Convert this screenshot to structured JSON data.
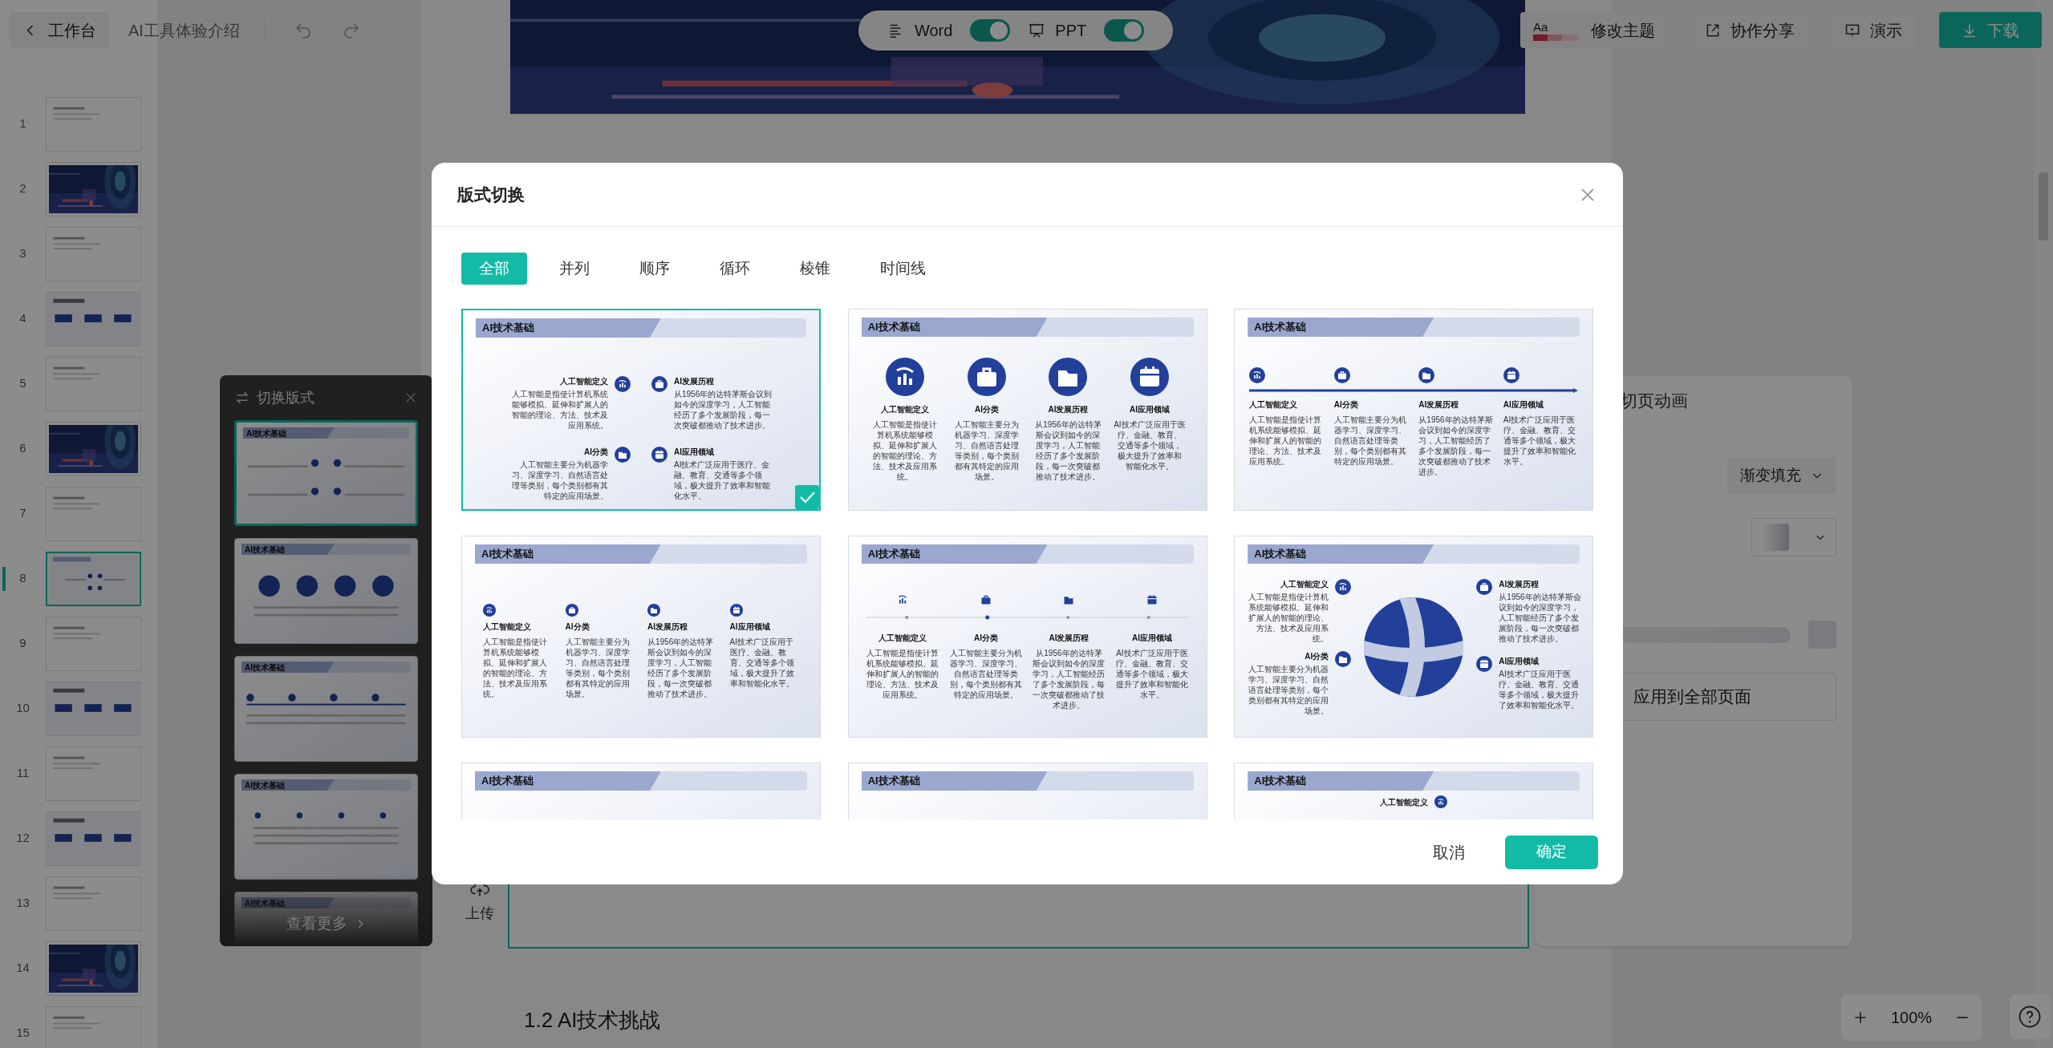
{
  "topbar": {
    "back": "工作台",
    "doc_title": "AI工具体验介绍",
    "toggles": [
      {
        "label": "Word",
        "on": true
      },
      {
        "label": "PPT",
        "on": true
      }
    ],
    "theme_icon": "Aa",
    "buttons": [
      {
        "kind": "theme",
        "label": "修改主题"
      },
      {
        "kind": "share",
        "label": "协作分享"
      },
      {
        "kind": "present",
        "label": "演示"
      },
      {
        "kind": "download",
        "label": "下载"
      }
    ]
  },
  "slides": [
    {
      "number": "1",
      "kind": "text",
      "selected": false
    },
    {
      "number": "2",
      "kind": "picture",
      "selected": false
    },
    {
      "number": "3",
      "kind": "text",
      "selected": false
    },
    {
      "number": "4",
      "kind": "boxes",
      "selected": false
    },
    {
      "number": "5",
      "kind": "text",
      "selected": false
    },
    {
      "number": "6",
      "kind": "picture",
      "selected": false
    },
    {
      "number": "7",
      "kind": "text",
      "selected": false
    },
    {
      "number": "8",
      "kind": "layout",
      "selected": true
    },
    {
      "number": "9",
      "kind": "text",
      "selected": false
    },
    {
      "number": "10",
      "kind": "boxes",
      "selected": false
    },
    {
      "number": "11",
      "kind": "text",
      "selected": false
    },
    {
      "number": "12",
      "kind": "boxes",
      "selected": false
    },
    {
      "number": "13",
      "kind": "text",
      "selected": false
    },
    {
      "number": "14",
      "kind": "picture",
      "selected": false
    },
    {
      "number": "15",
      "kind": "text",
      "selected": false
    }
  ],
  "canvas": {
    "upload": "上传",
    "section_heading": "1.2 AI技术挑战"
  },
  "switch_panel": {
    "title": "切换版式",
    "thumbnails": [
      {
        "kind": "two-column",
        "title": "AI技术基础",
        "selected": true
      },
      {
        "kind": "circles",
        "title": "AI技术基础",
        "selected": false
      },
      {
        "kind": "timeline",
        "title": "AI技术基础",
        "selected": false
      },
      {
        "kind": "columns",
        "title": "AI技术基础",
        "selected": false
      },
      {
        "kind": "cut",
        "title": "AI技术基础",
        "selected": false
      }
    ],
    "more": "查看更多"
  },
  "transition_panel": {
    "title": "切页动画",
    "fill_select": "渐变填充",
    "apply_button": "应用到全部页面"
  },
  "zoom": {
    "value": "100%"
  },
  "dialog": {
    "title": "版式切换",
    "tabs": [
      {
        "label": "全部",
        "selected": true
      },
      {
        "label": "并列",
        "selected": false
      },
      {
        "label": "顺序",
        "selected": false
      },
      {
        "label": "循环",
        "selected": false
      },
      {
        "label": "棱锥",
        "selected": false
      },
      {
        "label": "时间线",
        "selected": false
      }
    ],
    "layouts": [
      {
        "kind": "two-column",
        "selected": true,
        "title": "AI技术基础",
        "items": [
          {
            "heading": "人工智能定义",
            "text": "人工智能是指使计算机系统能够模拟、延伸和扩展人的智能的理论、方法、技术及应用系统。"
          },
          {
            "heading": "AI发展历程",
            "text": "从1956年的达特茅斯会议到如今的深度学习，人工智能经历了多个发展阶段，每一次突破都推动了技术进步。"
          },
          {
            "heading": "AI分类",
            "text": "人工智能主要分为机器学习、深度学习、自然语言处理等类别，每个类别都有其特定的应用场景。"
          },
          {
            "heading": "AI应用领域",
            "text": "AI技术广泛应用于医疗、金融、教育、交通等多个领域，极大提升了效率和智能化水平。"
          }
        ]
      },
      {
        "kind": "circles",
        "selected": false,
        "title": "AI技术基础",
        "items": [
          {
            "heading": "人工智能定义",
            "text": "人工智能是指使计算机系统能够模拟、延伸和扩展人的智能的理论、方法、技术及应用系统。"
          },
          {
            "heading": "AI分类",
            "text": "人工智能主要分为机器学习、深度学习、自然语言处理等类别，每个类别都有其特定的应用场景。"
          },
          {
            "heading": "AI发展历程",
            "text": "从1956年的达特茅斯会议到如今的深度学习，人工智能经历了多个发展阶段，每一次突破都推动了技术进步。"
          },
          {
            "heading": "AI应用领域",
            "text": "AI技术广泛应用于医疗、金融、教育、交通等多个领域，极大提升了效率和智能化水平。"
          }
        ]
      },
      {
        "kind": "timeline",
        "selected": false,
        "title": "AI技术基础",
        "items": [
          {
            "heading": "人工智能定义",
            "text": "人工智能是指使计算机系统能够模拟、延伸和扩展人的智能的理论、方法、技术及应用系统。"
          },
          {
            "heading": "AI分类",
            "text": "人工智能主要分为机器学习、深度学习、自然语言处理等类别，每个类别都有其特定的应用场景。"
          },
          {
            "heading": "AI发展历程",
            "text": "从1956年的达特茅斯会议到如今的深度学习，人工智能经历了多个发展阶段，每一次突破都推动了技术进步。"
          },
          {
            "heading": "AI应用领域",
            "text": "AI技术广泛应用于医疗、金融、教育、交通等多个领域，极大提升了效率和智能化水平。"
          }
        ]
      },
      {
        "kind": "columns",
        "selected": false,
        "title": "AI技术基础",
        "items": [
          {
            "heading": "人工智能定义",
            "text": "人工智能是指使计算机系统能够模拟、延伸和扩展人的智能的理论、方法、技术及应用系统。"
          },
          {
            "heading": "AI分类",
            "text": "人工智能主要分为机器学习、深度学习、自然语言处理等类别，每个类别都有其特定的应用场景。"
          },
          {
            "heading": "AI发展历程",
            "text": "从1956年的达特茅斯会议到如今的深度学习，人工智能经历了多个发展阶段，每一次突破都推动了技术进步。"
          },
          {
            "heading": "AI应用领域",
            "text": "AI技术广泛应用于医疗、金融、教育、交通等多个领域，极大提升了效率和智能化水平。"
          }
        ]
      },
      {
        "kind": "axis",
        "selected": false,
        "title": "AI技术基础",
        "items": [
          {
            "heading": "人工智能定义",
            "text": "人工智能是指使计算机系统能够模拟、延伸和扩展人的智能的理论、方法、技术及应用系统。"
          },
          {
            "heading": "AI分类",
            "text": "人工智能主要分为机器学习、深度学习、自然语言处理等类别，每个类别都有其特定的应用场景。"
          },
          {
            "heading": "AI发展历程",
            "text": "从1956年的达特茅斯会议到如今的深度学习，人工智能经历了多个发展阶段，每一次突破都推动了技术进步。"
          },
          {
            "heading": "AI应用领域",
            "text": "AI技术广泛应用于医疗、金融、教育、交通等多个领域，极大提升了效率和智能化水平。"
          }
        ]
      },
      {
        "kind": "sphere",
        "selected": false,
        "title": "AI技术基础",
        "items": [
          {
            "heading": "人工智能定义",
            "text": "人工智能是指使计算机系统能够模拟、延伸和扩展人的智能的理论、方法、技术及应用系统。"
          },
          {
            "heading": "AI发展历程",
            "text": "从1956年的达特茅斯会议到如今的深度学习，人工智能经历了多个发展阶段，每一次突破都推动了技术进步。"
          },
          {
            "heading": "AI分类",
            "text": "人工智能主要分为机器学习、深度学习、自然语言处理等类别，每个类别都有其特定的应用场景。"
          },
          {
            "heading": "AI应用领域",
            "text": "AI技术广泛应用于医疗、金融、教育、交通等多个领域，极大提升了效率和智能化水平。"
          }
        ]
      },
      {
        "kind": "cut",
        "selected": false,
        "title": "AI技术基础"
      },
      {
        "kind": "cut",
        "selected": false,
        "title": "AI技术基础"
      },
      {
        "kind": "cut",
        "selected": false,
        "title": "AI技术基础",
        "items": [
          {
            "heading": "人工智能定义"
          }
        ]
      }
    ],
    "cancel": "取消",
    "confirm": "确定"
  }
}
